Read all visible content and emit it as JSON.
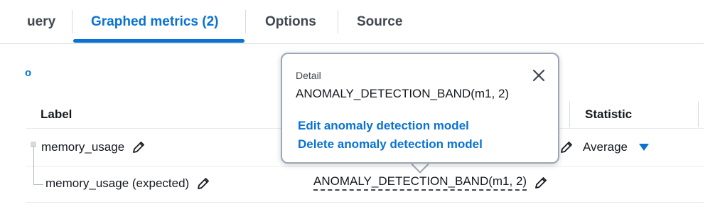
{
  "tabs": {
    "query": "uery",
    "graphed_metrics": "Graphed metrics (2)",
    "options": "Options",
    "source": "Source"
  },
  "cut_link": "o",
  "table": {
    "headers": {
      "label": "Label",
      "statistic": "Statistic"
    },
    "rows": [
      {
        "label": "memory_usage",
        "statistic": "Average"
      },
      {
        "label": "memory_usage (expected)",
        "details": "ANOMALY_DETECTION_BAND(m1, 2)"
      }
    ]
  },
  "popover": {
    "header": "Detail",
    "value": "ANOMALY_DETECTION_BAND(m1, 2)",
    "edit_link": "Edit anomaly detection model",
    "delete_link": "Delete anomaly detection model"
  },
  "icons": [
    "pencil-icon",
    "close-icon",
    "caret-down-icon"
  ],
  "colors": {
    "accent": "#0972d3",
    "text": "#16191f",
    "border": "#9ba7b6"
  }
}
